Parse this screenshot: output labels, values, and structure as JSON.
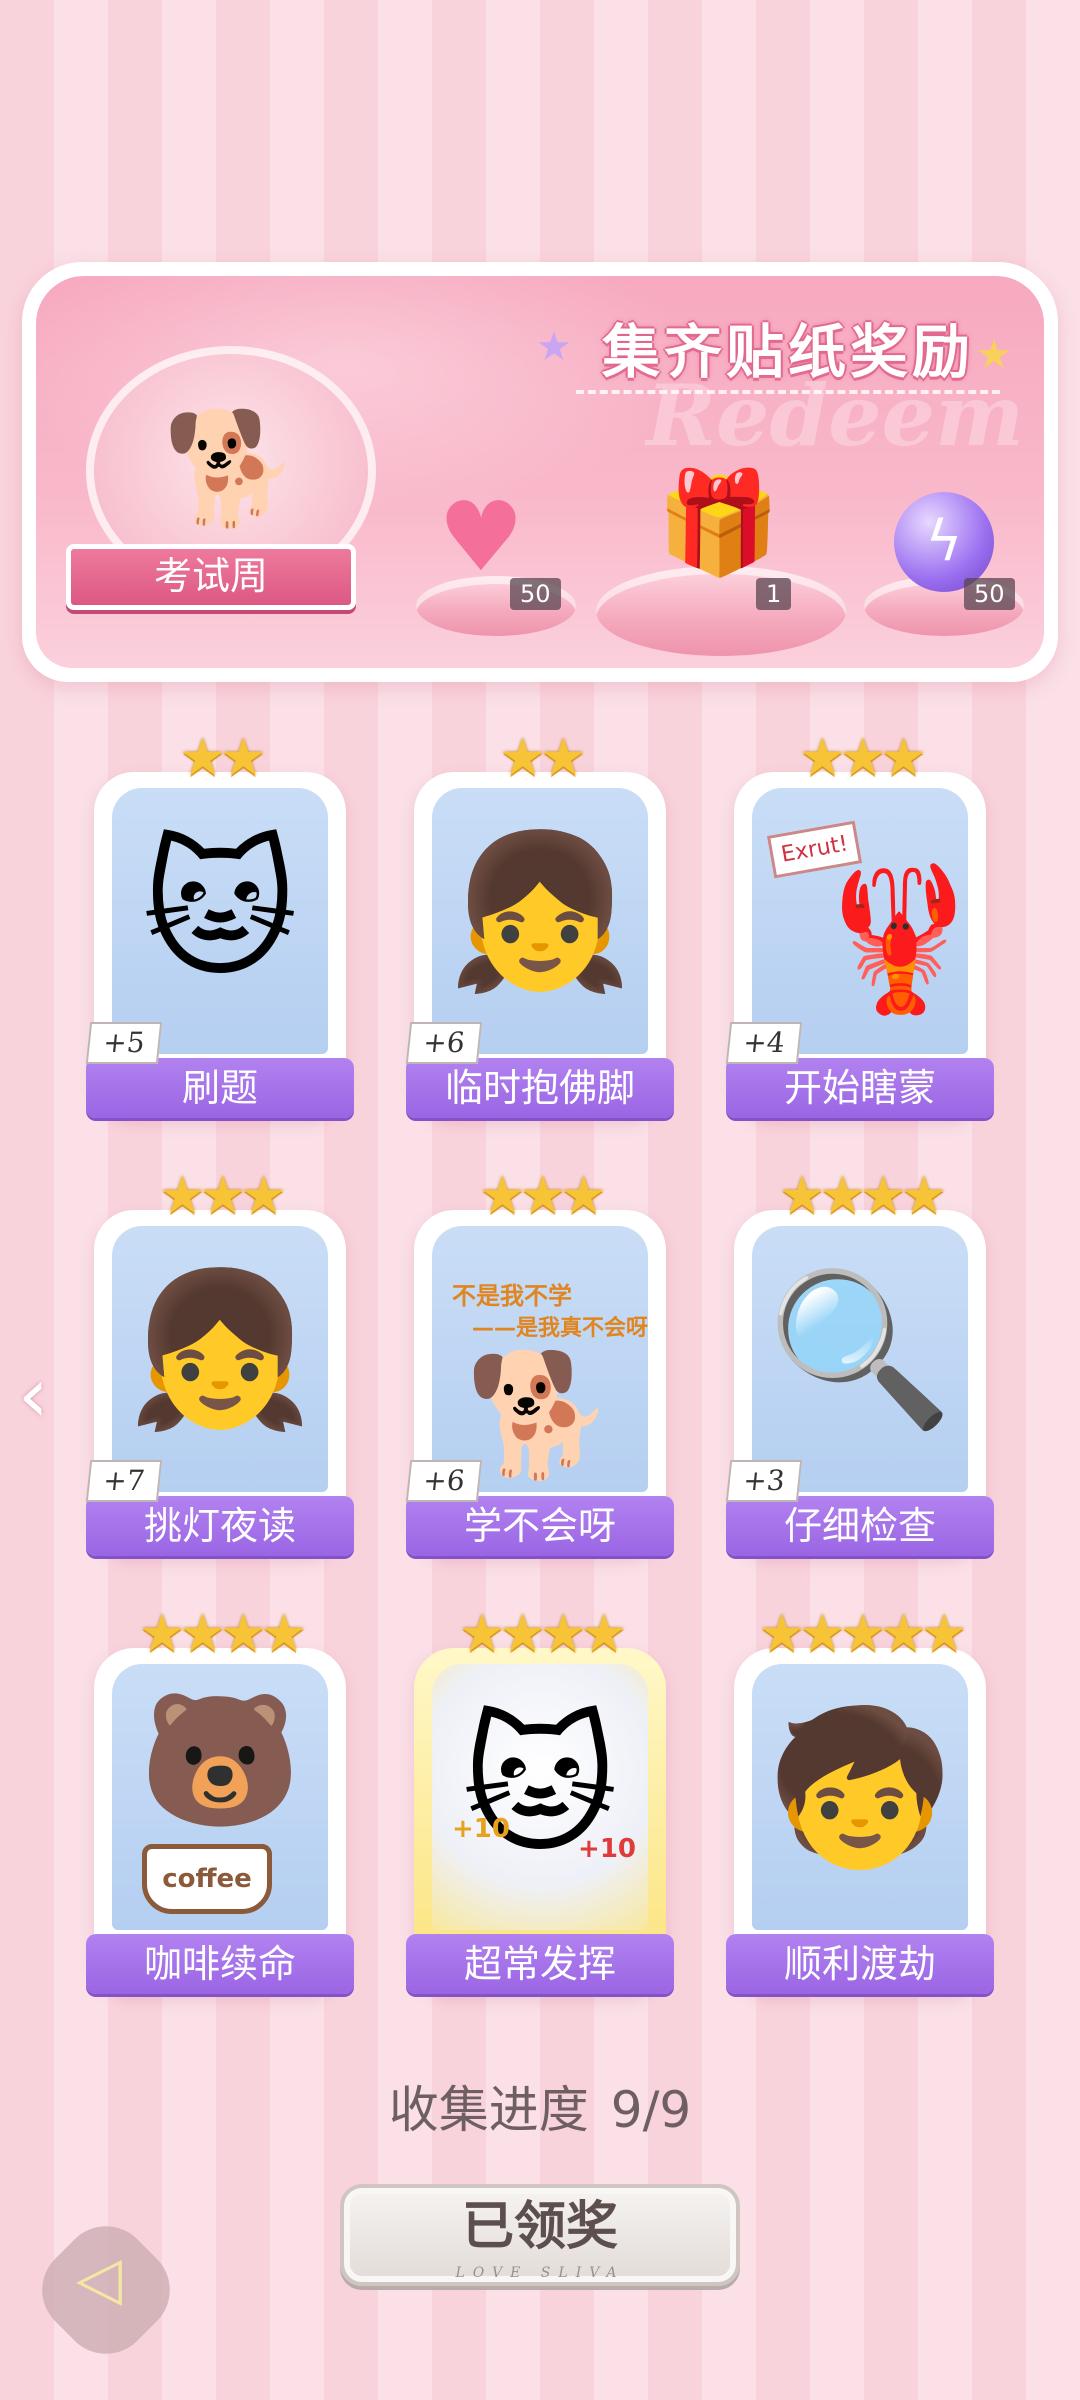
{
  "banner": {
    "title": "集齐贴纸奖励",
    "watermark": "Redeem",
    "theme_label": "考试周",
    "rewards": [
      {
        "icon": "heart-gem-icon",
        "count": "50"
      },
      {
        "icon": "gift-box-icon",
        "count": "1"
      },
      {
        "icon": "purple-orb-icon",
        "count": "50"
      }
    ]
  },
  "stickers": [
    {
      "name": "刷题",
      "bonus": "+5",
      "stars": "★★"
    },
    {
      "name": "临时抱佛脚",
      "bonus": "+6",
      "stars": "★★"
    },
    {
      "name": "开始瞎蒙",
      "bonus": "+4",
      "stars": "★★★"
    },
    {
      "name": "挑灯夜读",
      "bonus": "+7",
      "stars": "★★★"
    },
    {
      "name": "学不会呀",
      "bonus": "+6",
      "stars": "★★★"
    },
    {
      "name": "仔细检查",
      "bonus": "+3",
      "stars": "★★★★"
    },
    {
      "name": "咖啡续命",
      "bonus": "",
      "stars": "★★★★"
    },
    {
      "name": "超常发挥",
      "bonus": "",
      "stars": "★★★★"
    },
    {
      "name": "顺利渡劫",
      "bonus": "",
      "stars": "★★★★★"
    }
  ],
  "sticker_art_text": {
    "lobster_sign": "Exrut!",
    "slogan_line1": "不是我不学",
    "slogan_line2": "——是我真不会呀",
    "coffee": "coffee",
    "plus10": "+10"
  },
  "progress": {
    "label": "收集进度",
    "value": "9/9"
  },
  "claim_button": {
    "label": "已领奖",
    "sub": "LOVE SLIVA"
  },
  "colors": {
    "accent_purple": "#9a65e4",
    "pink": "#f7a9bf",
    "star_gold": "#f7c437"
  }
}
